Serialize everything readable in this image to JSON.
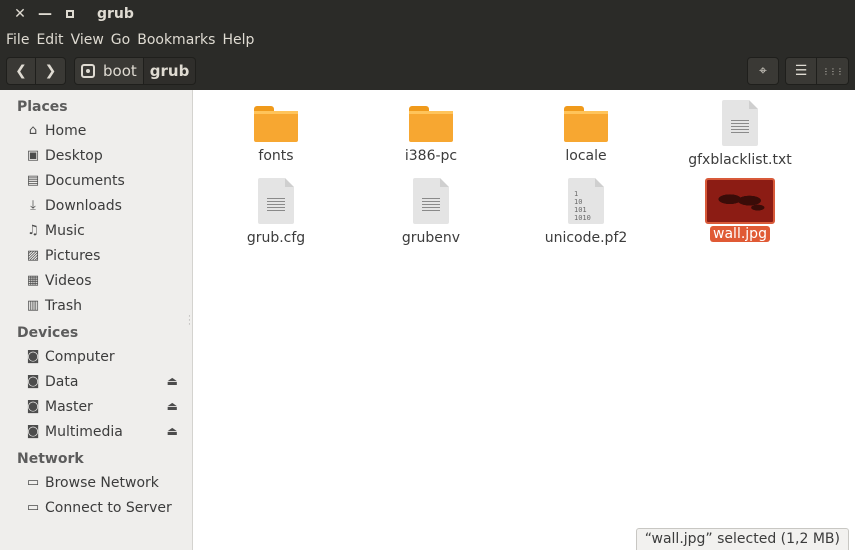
{
  "window": {
    "title": "grub"
  },
  "menu": [
    "File",
    "Edit",
    "View",
    "Go",
    "Bookmarks",
    "Help"
  ],
  "breadcrumbs": [
    "boot",
    "grub"
  ],
  "sidebar": {
    "places_header": "Places",
    "places": [
      {
        "label": "Home",
        "icon": "home-icon"
      },
      {
        "label": "Desktop",
        "icon": "desktop-icon"
      },
      {
        "label": "Documents",
        "icon": "documents-icon"
      },
      {
        "label": "Downloads",
        "icon": "downloads-icon"
      },
      {
        "label": "Music",
        "icon": "music-icon"
      },
      {
        "label": "Pictures",
        "icon": "pictures-icon"
      },
      {
        "label": "Videos",
        "icon": "videos-icon"
      },
      {
        "label": "Trash",
        "icon": "trash-icon"
      }
    ],
    "devices_header": "Devices",
    "devices": [
      {
        "label": "Computer",
        "icon": "drive-icon",
        "eject": false
      },
      {
        "label": "Data",
        "icon": "drive-icon",
        "eject": true
      },
      {
        "label": "Master",
        "icon": "drive-icon",
        "eject": true
      },
      {
        "label": "Multimedia",
        "icon": "drive-icon",
        "eject": true
      }
    ],
    "network_header": "Network",
    "network": [
      {
        "label": "Browse Network",
        "icon": "network-icon"
      },
      {
        "label": "Connect to Server",
        "icon": "server-icon"
      }
    ]
  },
  "files": [
    {
      "name": "fonts",
      "type": "folder"
    },
    {
      "name": "i386-pc",
      "type": "folder"
    },
    {
      "name": "locale",
      "type": "folder"
    },
    {
      "name": "gfxblacklist.txt",
      "type": "text"
    },
    {
      "name": "grub.cfg",
      "type": "text"
    },
    {
      "name": "grubenv",
      "type": "text"
    },
    {
      "name": "unicode.pf2",
      "type": "binary",
      "binary_text": "1\n10\n101\n1010"
    },
    {
      "name": "wall.jpg",
      "type": "image",
      "selected": true
    }
  ],
  "status": "“wall.jpg” selected  (1,2 MB)",
  "glyphs": {
    "close": "✕",
    "min": "—",
    "back": "❮",
    "fwd": "❯",
    "locate": "⌖",
    "list": "☰",
    "grid": "⋮⋮⋮",
    "eject": "⏏"
  },
  "colors": {
    "accent": "#e05a35",
    "folder": "#f7a731",
    "titlebar": "#2b2b28"
  }
}
